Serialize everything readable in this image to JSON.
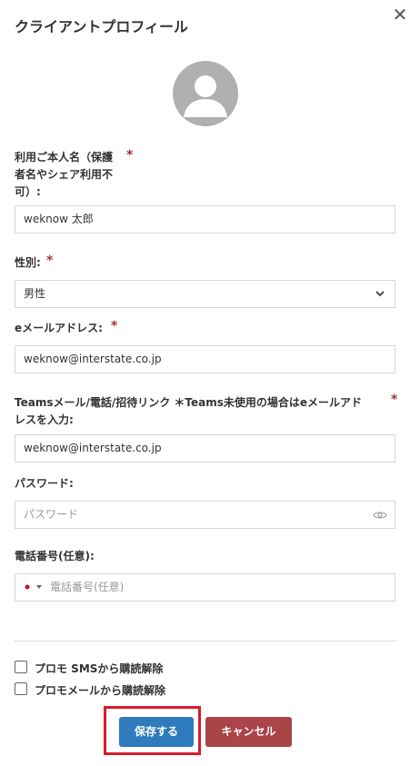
{
  "dialog": {
    "title": "クライアントプロフィール",
    "close_symbol": "✕"
  },
  "form": {
    "name": {
      "label_lines": [
        "利用ご本人名（保護",
        "者名やシェア利用不",
        "可）:"
      ],
      "required_mark": "*",
      "value": "weknow 太郎"
    },
    "gender": {
      "label": "性別:",
      "required_mark": "*",
      "selected": "男性"
    },
    "email": {
      "label": "eメールアドレス:",
      "required_mark": "*",
      "value": "weknow@interstate.co.jp"
    },
    "teams": {
      "label_lines": [
        "Teamsメール/電話/招待リンク ＊Teams未使用の場合はeメールアド",
        "レスを入力:"
      ],
      "required_mark": "*",
      "value": "weknow@interstate.co.jp"
    },
    "password": {
      "label": "パスワード:",
      "placeholder": "パスワード"
    },
    "phone": {
      "label": "電話番号(任意):",
      "placeholder": "電話番号(任意)",
      "country_flag": "jp"
    }
  },
  "options": [
    {
      "label": "プロモ SMSから購読解除",
      "checked": false
    },
    {
      "label": "プロモメールから購読解除",
      "checked": false
    }
  ],
  "buttons": {
    "save": "保存する",
    "cancel": "キャンセル"
  },
  "colors": {
    "required": "#a83232",
    "save": "#2f7bbd",
    "cancel": "#a94448",
    "highlight": "#d81b2a"
  }
}
